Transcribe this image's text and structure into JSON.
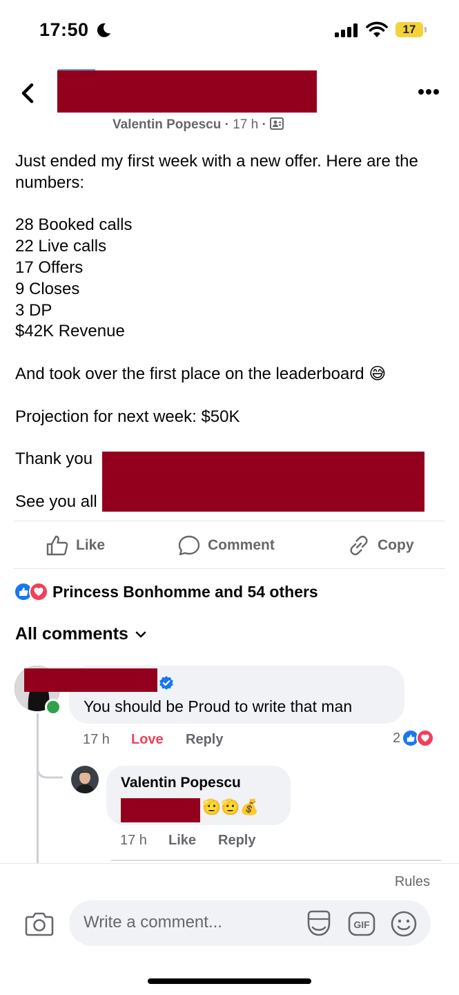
{
  "status_bar": {
    "time": "17:50",
    "battery": "17"
  },
  "header": {
    "author": "Valentin Popescu",
    "time": "17 h"
  },
  "post": {
    "text": "Just ended my first week with a new offer. Here are the numbers:\n\n28 Booked calls\n22 Live calls\n17 Offers\n9 Closes\n3 DP\n$42K Revenue\n\nAnd took over the first place on the leaderboard 😅\n\nProjection for next week: $50K\n\nThank you\n\nSee you all"
  },
  "actions": {
    "like": "Like",
    "comment": "Comment",
    "copy": "Copy"
  },
  "reactions": {
    "summary": "Princess Bonhomme and 54 others"
  },
  "comments_header": "All comments",
  "comments": [
    {
      "text": "You should be Proud to write that man",
      "time": "17 h",
      "love": "Love",
      "reply": "Reply",
      "reaction_count": "2"
    },
    {
      "author": "Valentin Popescu",
      "emojis": "🫡🫡💰",
      "time": "17 h",
      "like": "Like",
      "reply": "Reply"
    }
  ],
  "composer": {
    "rules": "Rules",
    "placeholder": "Write a comment..."
  },
  "colors": {
    "accent": "#1877f2",
    "love": "#f33e58",
    "redaction": "#93001e",
    "online": "#31a24c"
  }
}
